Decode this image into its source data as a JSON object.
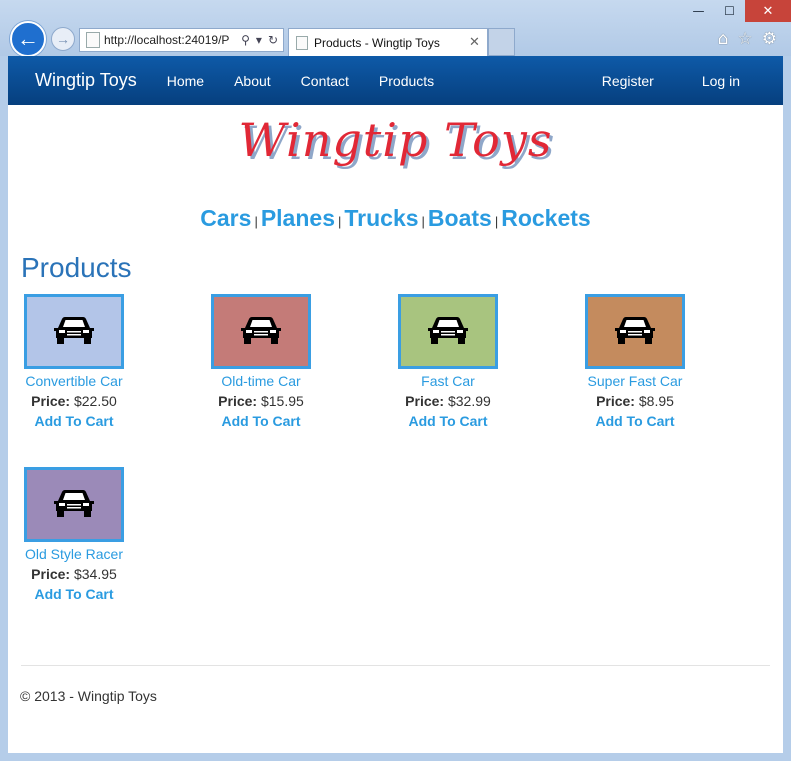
{
  "browser": {
    "url": "http://localhost:24019/P",
    "tab_title": "Products - Wingtip Toys",
    "controls": {
      "minimize": "—",
      "maximize": "☐",
      "close": "✕"
    }
  },
  "nav": {
    "brand": "Wingtip Toys",
    "links": [
      "Home",
      "About",
      "Contact",
      "Products"
    ],
    "right_links": [
      "Register",
      "Log in"
    ]
  },
  "logo_text": "Wingtip Toys",
  "categories": [
    "Cars",
    "Planes",
    "Trucks",
    "Boats",
    "Rockets"
  ],
  "category_separator": "|",
  "page_title": "Products",
  "price_label": "Price:",
  "add_to_cart_label": "Add To Cart",
  "products": [
    {
      "name": "Convertible Car",
      "price": "$22.50",
      "color": "#b3c5e8"
    },
    {
      "name": "Old-time Car",
      "price": "$15.95",
      "color": "#c47b78"
    },
    {
      "name": "Fast Car",
      "price": "$32.99",
      "color": "#a8c47f"
    },
    {
      "name": "Super Fast Car",
      "price": "$8.95",
      "color": "#c48b5e"
    },
    {
      "name": "Old Style Racer",
      "price": "$34.95",
      "color": "#9b8ab8"
    }
  ],
  "footer": "© 2013 - Wingtip Toys"
}
